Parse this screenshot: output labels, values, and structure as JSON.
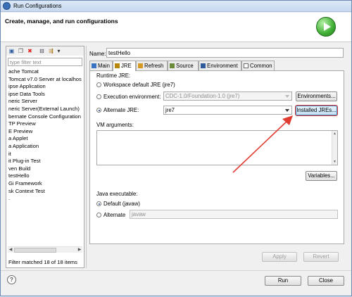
{
  "window": {
    "title": "Run Configurations"
  },
  "header": {
    "title": "Create, manage, and run configurations"
  },
  "left": {
    "filter_placeholder": "type filter text",
    "toolbar_glyphs": {
      "new": "▣",
      "dup": "❐",
      "delete": "✖",
      "collapse": "⊟",
      "filter": "⇶",
      "menu": "▾"
    },
    "items": [
      "ache Tomcat",
      "Tomcat v7.0 Server at localhos",
      "ipse Application",
      "ipse Data Tools",
      "neric Server",
      "neric Server(External Launch)",
      "bernate Console Configuration",
      "TP Preview",
      "E Preview",
      "a Applet",
      "a Application",
      "it",
      "it Plug-in Test",
      "ven Build",
      "testHello",
      "Gi Framework",
      "sk Context Test",
      "."
    ],
    "status": "Filter matched 18 of 18 items",
    "scroll_left": "◀",
    "scroll_right": "▶"
  },
  "name": {
    "label": "Name:",
    "value": "testHello"
  },
  "tabs": [
    {
      "label": "Main",
      "icon": "main-icon",
      "color": "#3a73c0"
    },
    {
      "label": "JRE",
      "icon": "jre-icon",
      "color": "#b8860b"
    },
    {
      "label": "Refresh",
      "icon": "refresh-icon",
      "color": "#d69a24"
    },
    {
      "label": "Source",
      "icon": "source-icon",
      "color": "#6a8c3a"
    },
    {
      "label": "Environment",
      "icon": "environment-icon",
      "color": "#2f5a9e"
    },
    {
      "label": "Common",
      "icon": "common-icon",
      "color": "#6b6b6b"
    }
  ],
  "jre": {
    "runtime_label": "Runtime JRE:",
    "workspace_default": "Workspace default JRE (jre7)",
    "execution_environment": "Execution environment:",
    "ee_value": "CDC-1.0/Foundation-1.0 (jre7)",
    "environments_button": "Environments...",
    "alternate_jre": "Alternate JRE:",
    "alternate_value": "jre7",
    "installed_jres_button": "Installed JREs...",
    "vm_arguments": "VM arguments:",
    "variables_button": "Variables...",
    "java_executable": "Java executable:",
    "default_label": "Default (javaw)",
    "alternate_label": "Alternate",
    "alternate_field": "javaw",
    "scroll_up": "▲",
    "scroll_down": "▼"
  },
  "buttons": {
    "apply": "Apply",
    "revert": "Revert",
    "run": "Run",
    "close": "Close",
    "help": "?"
  },
  "colors": {
    "accent_arrow": "#e03c31",
    "run_green": "#3fae34"
  }
}
